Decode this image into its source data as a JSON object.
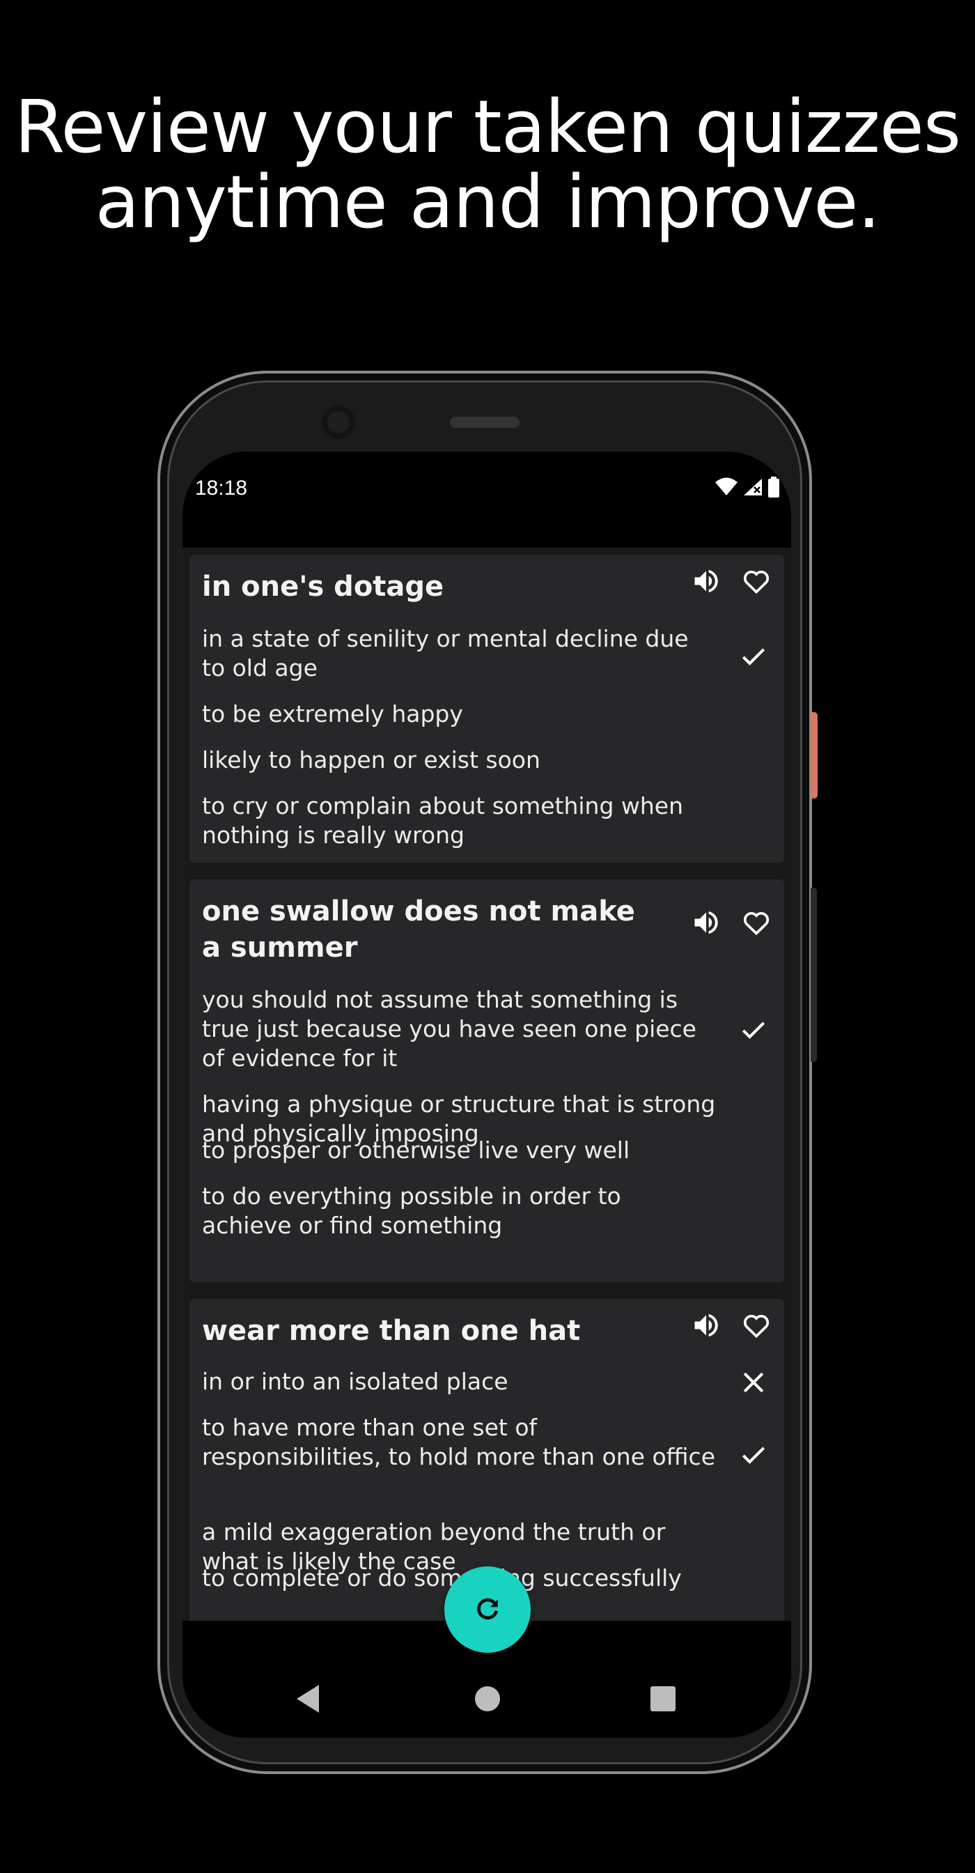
{
  "headline": {
    "line1": "Review your taken quizzes",
    "line2": "anytime and improve."
  },
  "status": {
    "time": "18:18"
  },
  "cards": [
    {
      "title": "in one's dotage",
      "options": [
        {
          "text": "in a state of senility or mental decline due to old age",
          "mark": "check"
        },
        {
          "text": "to be extremely happy",
          "mark": ""
        },
        {
          "text": "likely to happen or exist soon",
          "mark": ""
        },
        {
          "text": "to cry or complain about something when nothing is really wrong",
          "mark": ""
        }
      ]
    },
    {
      "title": "one swallow does not make a summer",
      "options": [
        {
          "text": "you should not assume that something is true just because you have seen one piece of evidence for it",
          "mark": "check"
        },
        {
          "text": "having a physique or structure that is strong and physically imposing",
          "mark": ""
        },
        {
          "text": "to prosper or otherwise live very well",
          "mark": ""
        },
        {
          "text": "to do everything possible in order to achieve or find something",
          "mark": ""
        }
      ]
    },
    {
      "title": "wear more than one hat",
      "options": [
        {
          "text": "in or into an isolated place",
          "mark": "cross"
        },
        {
          "text": "to have more than one set of responsibilities, to hold more than one office",
          "mark": "check"
        },
        {
          "text": "a mild exaggeration beyond the truth or what is likely the case",
          "mark": ""
        },
        {
          "text": "to complete or do something successfully",
          "mark": ""
        }
      ]
    }
  ],
  "icons": {
    "speaker": "volume-icon",
    "favorite": "heart-outline-icon",
    "correct": "check-icon",
    "wrong": "close-icon",
    "fab": "refresh-icon"
  },
  "colors": {
    "background": "#000000",
    "card": "#272729",
    "fab": "#18d3c0",
    "accent_button": "#d9785d"
  }
}
